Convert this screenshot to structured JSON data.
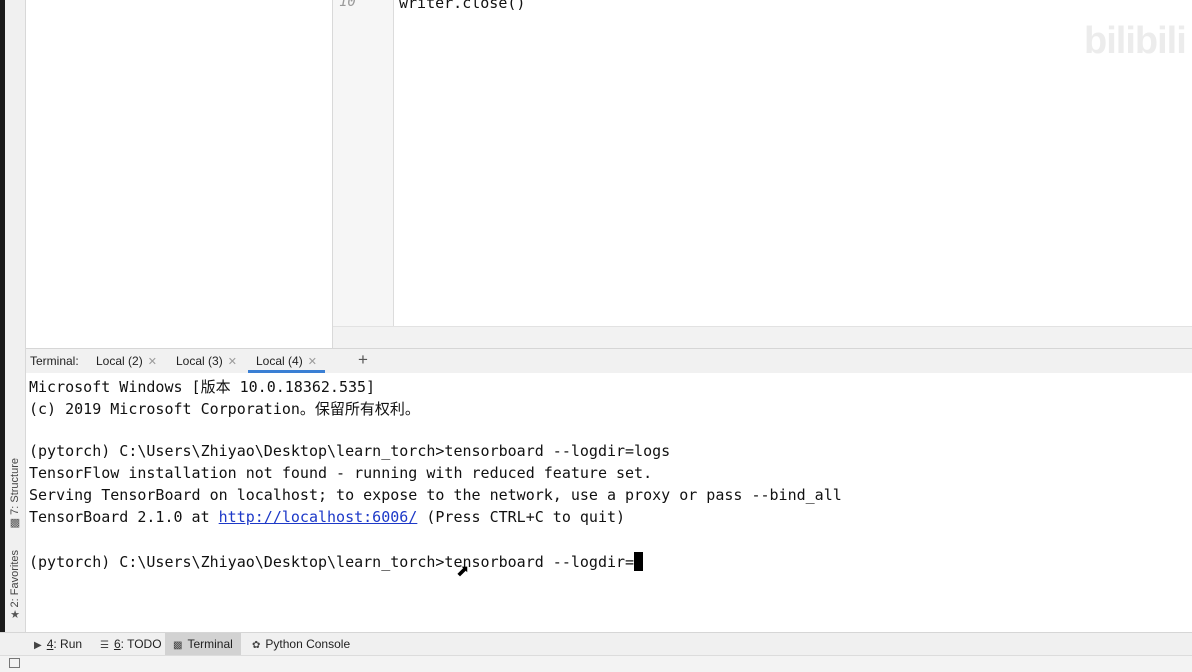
{
  "side_tabs": {
    "structure_label": "7: Structure",
    "favorites_label": "2: Favorites"
  },
  "editor": {
    "line_number": "10",
    "code_line": "writer.close()"
  },
  "watermark": "bilibili",
  "terminal": {
    "title": "Terminal:",
    "tabs": [
      {
        "label": "Local (2)"
      },
      {
        "label": "Local (3)"
      },
      {
        "label": "Local (4)"
      }
    ],
    "active_tab": "Local (4)",
    "add_label": "+",
    "lines": {
      "l1": "Microsoft Windows [版本 10.0.18362.535]",
      "l2": "(c) 2019 Microsoft Corporation。保留所有权利。",
      "l3": "(pytorch) C:\\Users\\Zhiyao\\Desktop\\learn_torch>tensorboard --logdir=logs",
      "l4": "TensorFlow installation not found - running with reduced feature set.",
      "l5": "Serving TensorBoard on localhost; to expose to the network, use a proxy or pass --bind_all",
      "l6_prefix": "TensorBoard 2.1.0 at ",
      "l6_link": "http://localhost:6006/",
      "l6_suffix": " (Press CTRL+C to quit)",
      "l7": "(pytorch) C:\\Users\\Zhiyao\\Desktop\\learn_torch>tensorboard --logdir="
    }
  },
  "bottom_tabs": {
    "run_num": "4",
    "run_label": ": Run",
    "todo_num": "6",
    "todo_label": ": TODO",
    "terminal_label": "Terminal",
    "python_console_label": "Python Console"
  },
  "icons": {
    "run": "play-icon",
    "todo": "list-icon",
    "terminal": "terminal-icon",
    "python_console": "python-icon",
    "favorites": "star-icon",
    "structure": "structure-icon"
  },
  "colors": {
    "active_tab_underline": "#3a7fd4",
    "link": "#1d39c8"
  }
}
